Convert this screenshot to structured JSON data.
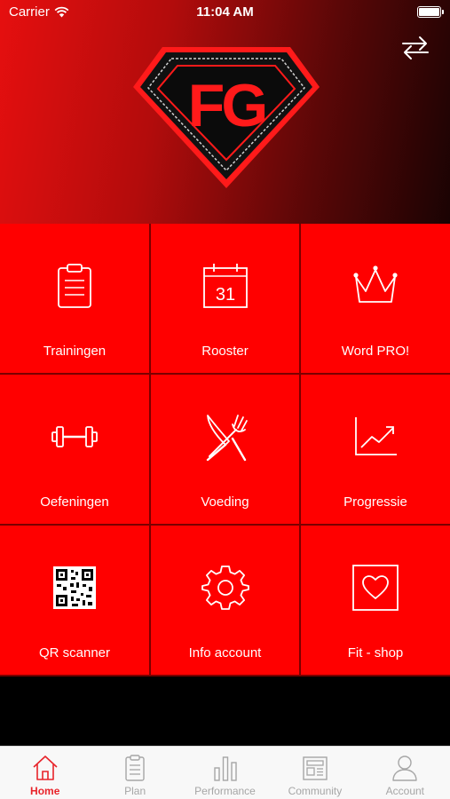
{
  "status_bar": {
    "carrier": "Carrier",
    "time": "11:04 AM"
  },
  "header": {
    "logo_text": "FG"
  },
  "tiles": [
    {
      "label": "Trainingen",
      "icon": "clipboard-icon"
    },
    {
      "label": "Rooster",
      "icon": "calendar-icon",
      "calendar_day": "31"
    },
    {
      "label": "Word PRO!",
      "icon": "crown-icon"
    },
    {
      "label": "Oefeningen",
      "icon": "dumbbell-icon"
    },
    {
      "label": "Voeding",
      "icon": "knife-fork-icon"
    },
    {
      "label": "Progressie",
      "icon": "trend-chart-icon"
    },
    {
      "label": "QR scanner",
      "icon": "qr-code-icon"
    },
    {
      "label": "Info account",
      "icon": "gear-icon"
    },
    {
      "label": "Fit - shop",
      "icon": "heart-frame-icon"
    }
  ],
  "tabs": [
    {
      "label": "Home",
      "icon": "home-icon",
      "active": true
    },
    {
      "label": "Plan",
      "icon": "plan-icon",
      "active": false
    },
    {
      "label": "Performance",
      "icon": "bar-chart-icon",
      "active": false
    },
    {
      "label": "Community",
      "icon": "newspaper-icon",
      "active": false
    },
    {
      "label": "Account",
      "icon": "user-icon",
      "active": false
    }
  ],
  "colors": {
    "tile_red": "#ff0000",
    "accent": "#e8232a",
    "inactive_tab": "#a6a6a6"
  }
}
